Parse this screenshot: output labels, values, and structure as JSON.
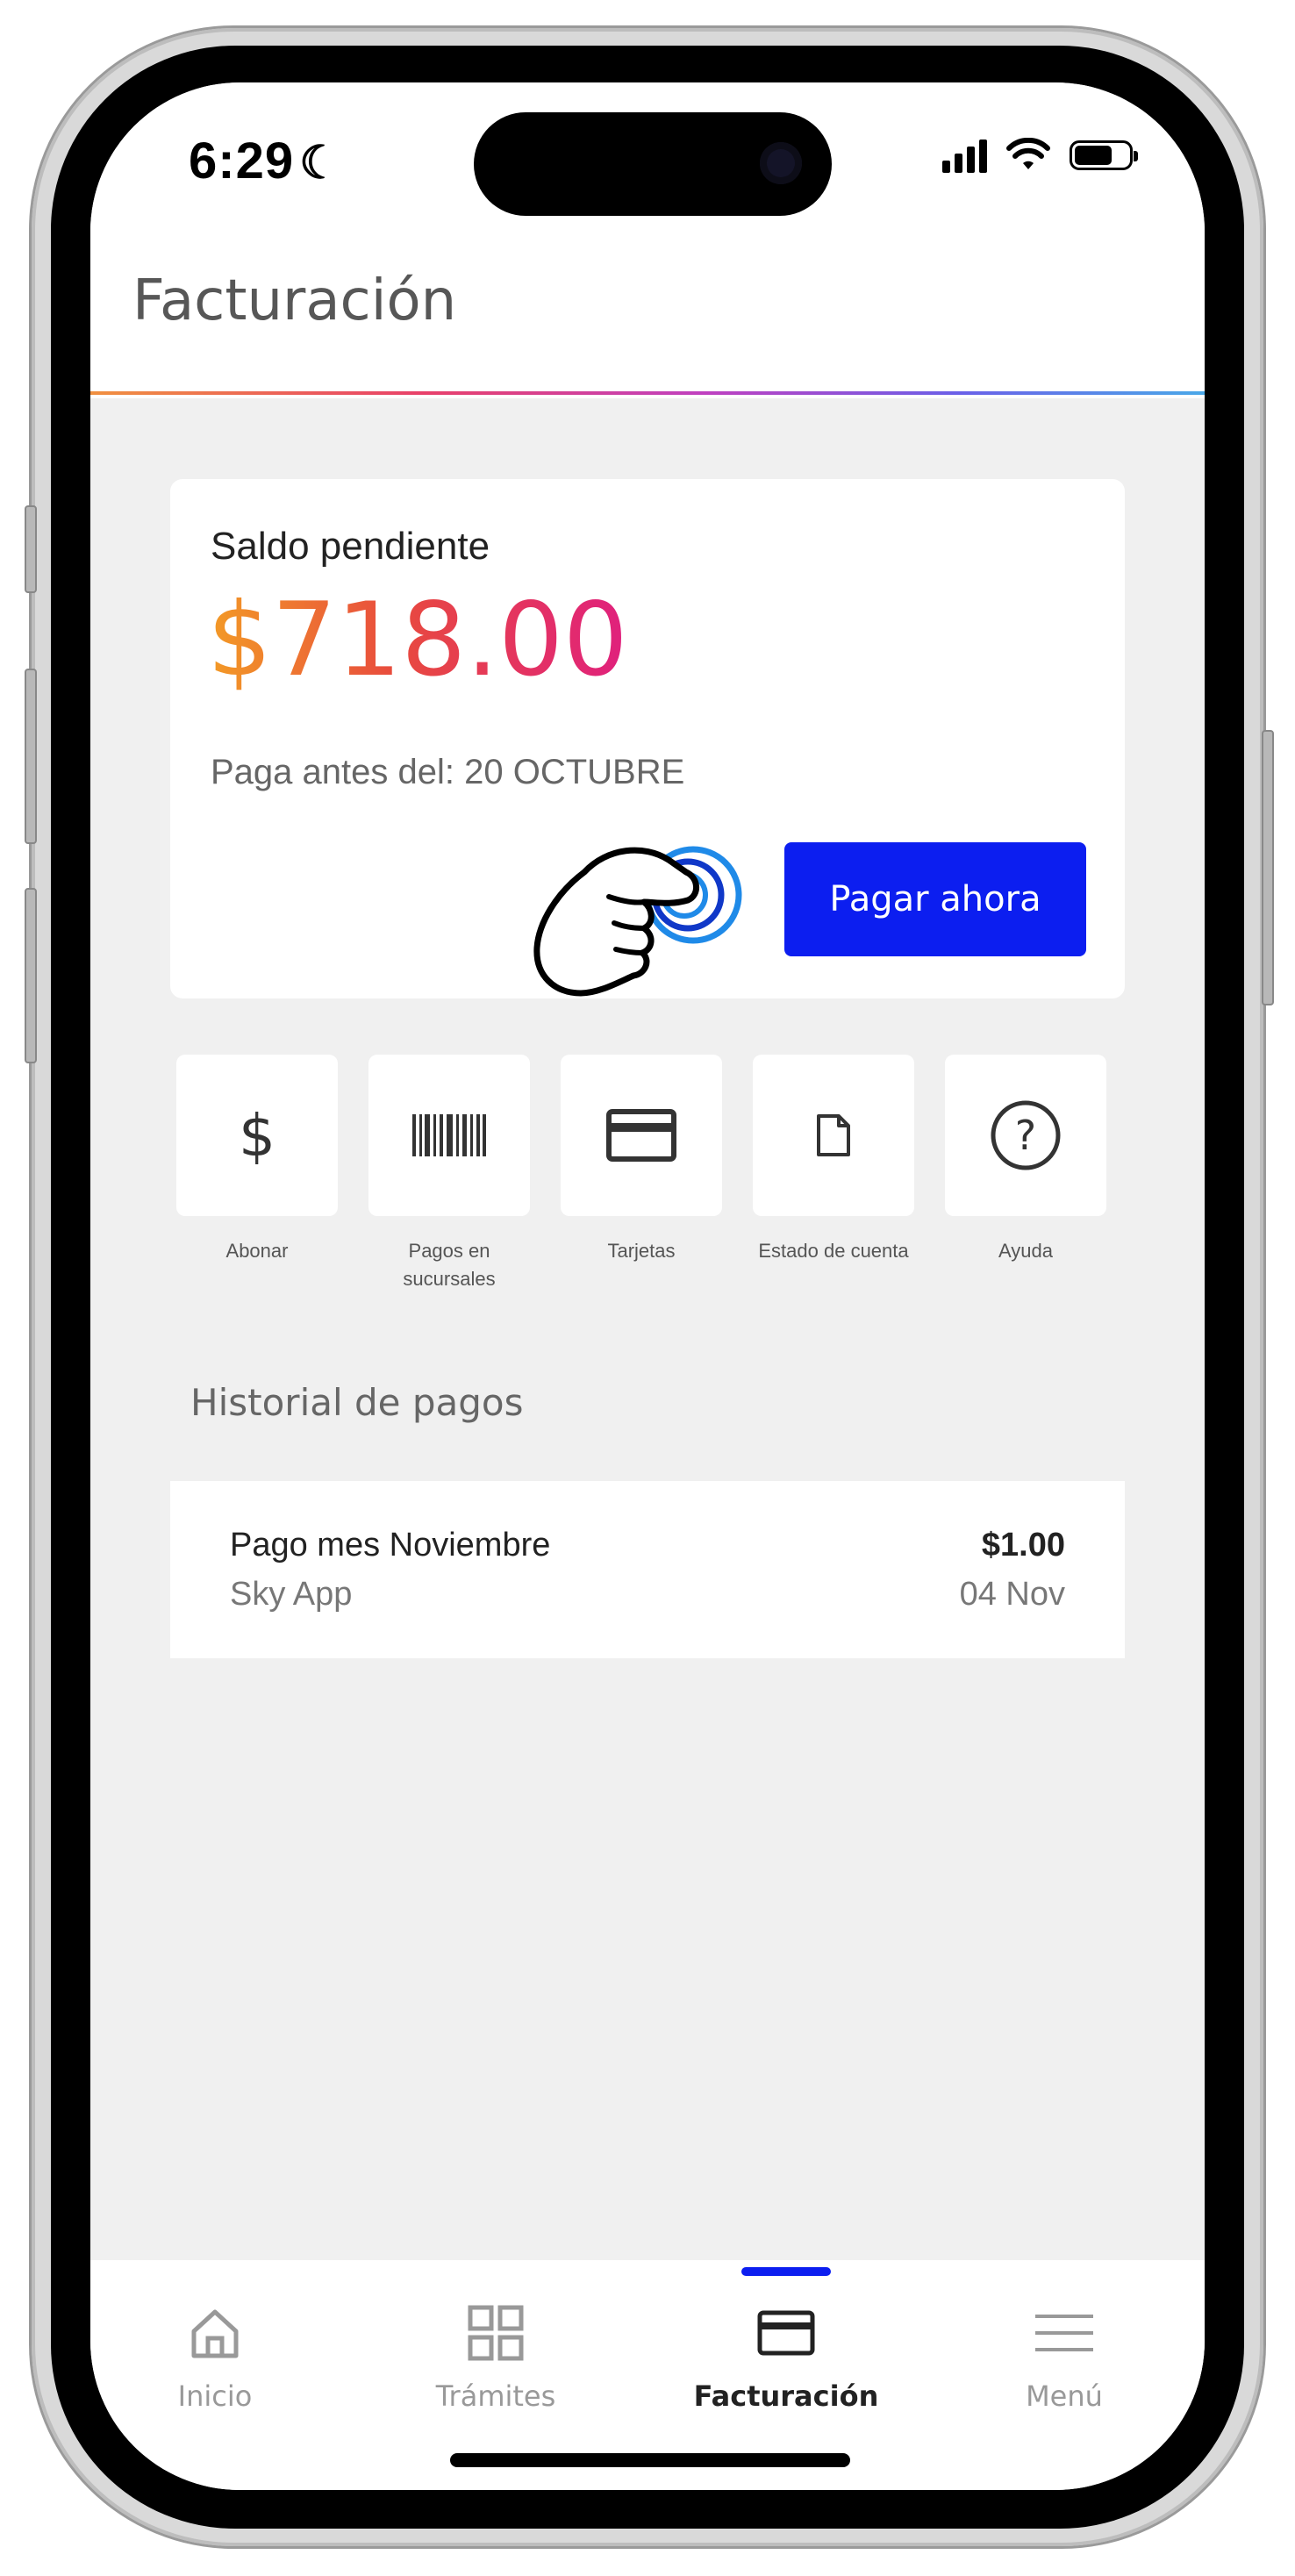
{
  "status": {
    "time": "6:29",
    "moon": "☾"
  },
  "header": {
    "title": "Facturación"
  },
  "balance": {
    "label": "Saldo pendiente",
    "amount": "$718.00",
    "due": "Paga antes del: 20 OCTUBRE",
    "pay_button": "Pagar ahora"
  },
  "actions": [
    {
      "icon": "dollar-icon",
      "label": "Abonar"
    },
    {
      "icon": "barcode-icon",
      "label": "Pagos en sucursales"
    },
    {
      "icon": "credit-card-icon",
      "label": "Tarjetas"
    },
    {
      "icon": "document-icon",
      "label": "Estado de cuenta"
    },
    {
      "icon": "help-circle-icon",
      "label": "Ayuda"
    }
  ],
  "history": {
    "title": "Historial de pagos",
    "items": [
      {
        "name": "Pago mes Noviembre",
        "source": "Sky App",
        "amount": "$1.00",
        "date": "04 Nov"
      }
    ]
  },
  "tabs": [
    {
      "icon": "home-icon",
      "label": "Inicio",
      "active": false
    },
    {
      "icon": "grid-icon",
      "label": "Trámites",
      "active": false
    },
    {
      "icon": "card-icon",
      "label": "Facturación",
      "active": true
    },
    {
      "icon": "menu-icon",
      "label": "Menú",
      "active": false
    }
  ],
  "colors": {
    "accent": "#0c1ef0",
    "amount_gradient_start": "#f39b26",
    "amount_gradient_end": "#e0207e"
  }
}
